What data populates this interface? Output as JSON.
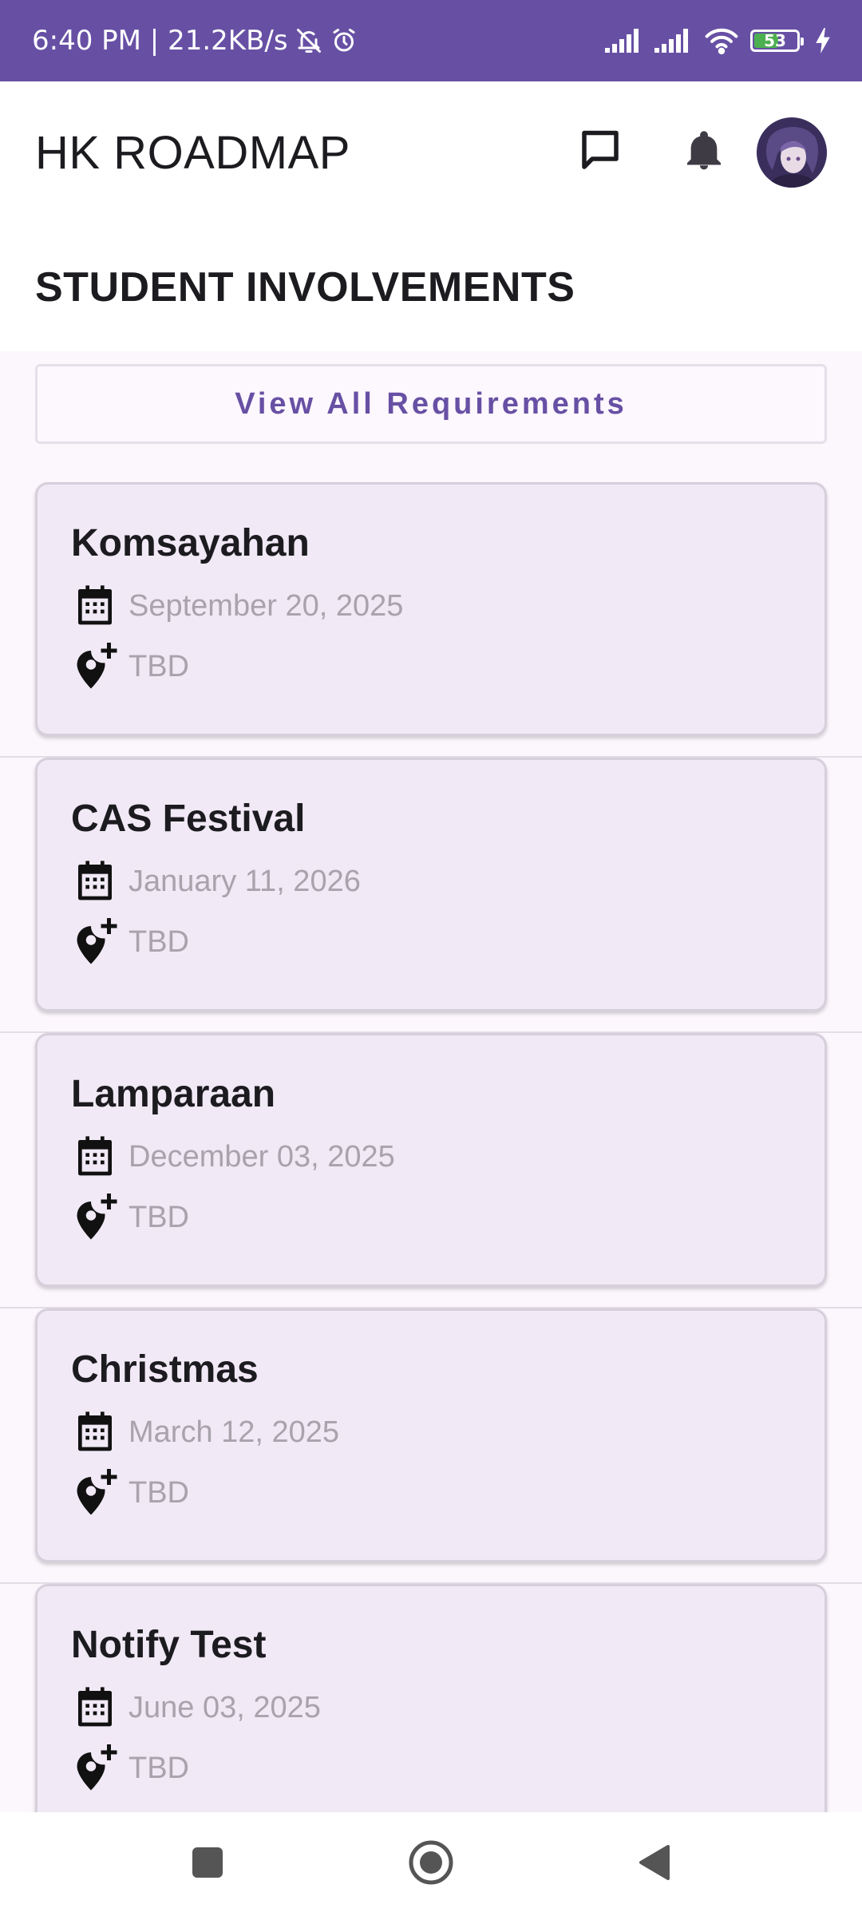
{
  "status_bar": {
    "time_speed": "6:40 PM | 21.2KB/s",
    "battery_level": "53",
    "battery_fraction": 0.53,
    "icons": [
      "mute-bell-icon",
      "alarm-icon",
      "signal-icon",
      "signal-icon",
      "wifi-icon",
      "battery-icon",
      "charging-icon"
    ]
  },
  "app_bar": {
    "title": "HK ROADMAP",
    "actions": [
      "chat-icon",
      "bell-icon",
      "avatar"
    ]
  },
  "section": {
    "title": "STUDENT INVOLVEMENTS"
  },
  "view_all_button": {
    "label": "View All Requirements"
  },
  "events": [
    {
      "title": "Komsayahan",
      "date": "September 20, 2025",
      "location": "TBD"
    },
    {
      "title": "CAS Festival",
      "date": "January 11, 2026",
      "location": "TBD"
    },
    {
      "title": "Lamparaan",
      "date": "December 03, 2025",
      "location": "TBD"
    },
    {
      "title": "Christmas",
      "date": "March 12, 2025",
      "location": "TBD"
    },
    {
      "title": "Notify Test",
      "date": "June 03, 2025",
      "location": "TBD"
    }
  ],
  "nav_bar": {
    "buttons": [
      "recents-square-icon",
      "home-circle-icon",
      "back-triangle-icon"
    ]
  },
  "colors": {
    "accent": "#6750a4",
    "card_bg": "#f1e9f6",
    "content_bg": "#fcf7fd",
    "muted_text": "#a8a3ac",
    "battery_fill": "#4caf50"
  }
}
